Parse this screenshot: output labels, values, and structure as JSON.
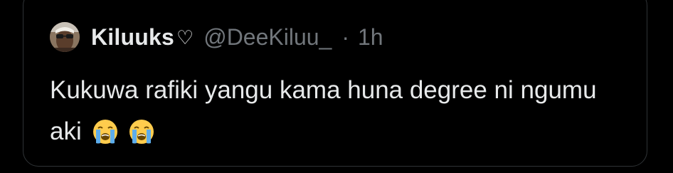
{
  "tweet": {
    "author": {
      "display_name": "Kiluuks",
      "name_suffix_icon": "white-heart-icon",
      "name_suffix_glyph": "♡",
      "handle": "@DeeKiluu_",
      "separator": "·",
      "time": "1h",
      "avatar_icon": "profile-avatar"
    },
    "text": "Kukuwa rafiki yangu kama huna degree ni ngumu aki",
    "emojis": [
      "loudly-crying-face-icon",
      "loudly-crying-face-icon"
    ]
  },
  "colors": {
    "background": "#000000",
    "primary_text": "#e7e9ea",
    "secondary_text": "#71767b",
    "border": "#2f3336",
    "emoji_face": "#ffcc4d",
    "emoji_tears": "#5dadec"
  }
}
